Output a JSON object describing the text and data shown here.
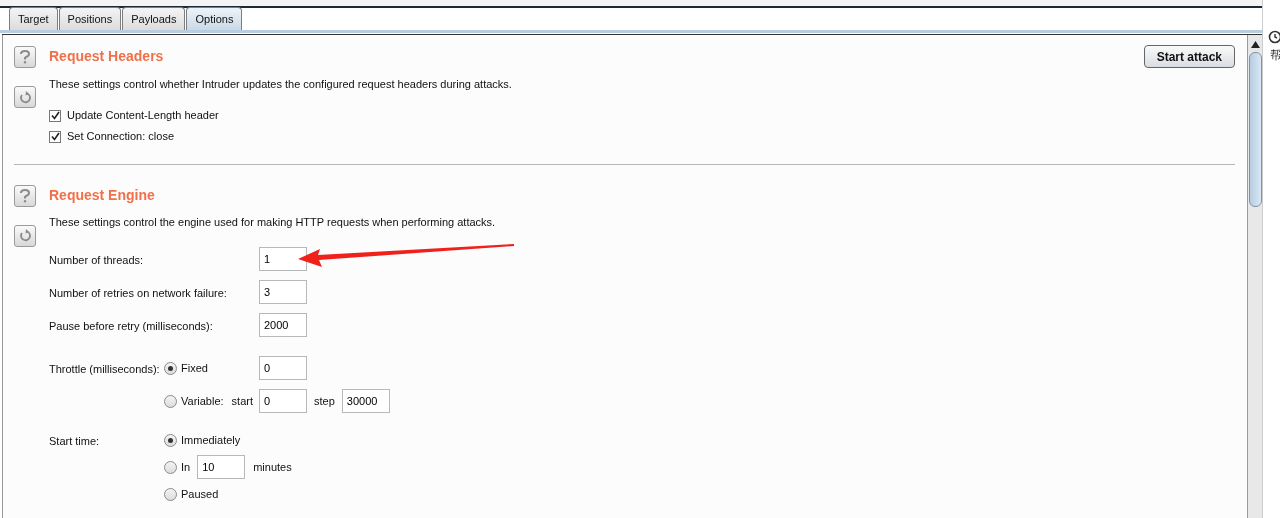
{
  "tabs": [
    {
      "label": "Target",
      "selected": false
    },
    {
      "label": "Positions",
      "selected": false
    },
    {
      "label": "Payloads",
      "selected": false
    },
    {
      "label": "Options",
      "selected": true
    }
  ],
  "start_button": "Start attack",
  "sections": [
    {
      "kind": "headers",
      "title": "Request Headers",
      "description": "These settings control whether Intruder updates the configured request headers during attacks.",
      "checkboxes": [
        {
          "label": "Update Content-Length header",
          "checked": true
        },
        {
          "label": "Set Connection: close",
          "checked": true
        }
      ]
    },
    {
      "kind": "engine",
      "title": "Request Engine",
      "description": "These settings control the engine used for making HTTP requests when performing attacks.",
      "fields": [
        {
          "label": "Number of threads:",
          "value": "1"
        },
        {
          "label": "Number of retries on network failure:",
          "value": "3"
        },
        {
          "label": "Pause before retry (milliseconds):",
          "value": "2000"
        }
      ],
      "throttle": {
        "label": "Throttle (milliseconds):",
        "options": [
          {
            "kind": "fixed",
            "label": "Fixed",
            "selected": true,
            "value": "0"
          },
          {
            "kind": "variable",
            "label": "Variable:",
            "selected": false,
            "start_label": "start",
            "start_value": "0",
            "step_label": "step",
            "step_value": "30000"
          }
        ]
      },
      "start_time": {
        "label": "Start time:",
        "options": [
          {
            "kind": "plain",
            "label": "Immediately",
            "selected": true
          },
          {
            "kind": "delay",
            "label": "In",
            "selected": false,
            "value": "10",
            "unit": "minutes"
          },
          {
            "kind": "plain",
            "label": "Paused",
            "selected": false
          }
        ]
      }
    }
  ],
  "side_panel": {
    "text": "帮"
  }
}
